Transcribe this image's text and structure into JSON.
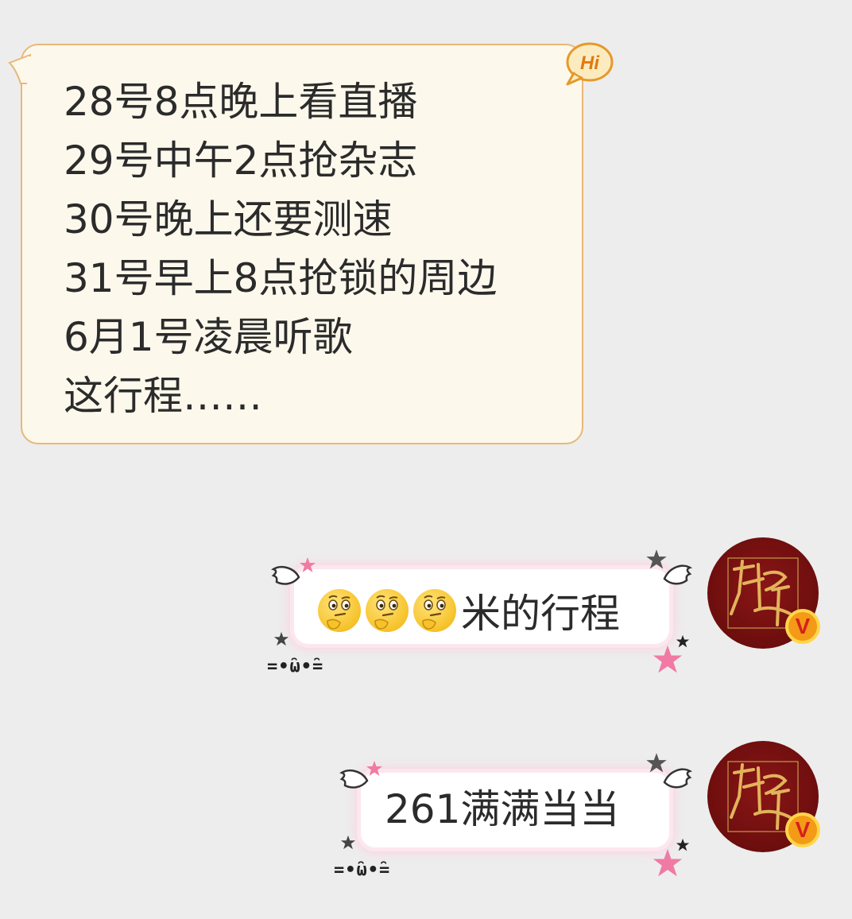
{
  "received_message": {
    "lines": [
      "28号8点晚上看直播",
      "29号中午2点抢杂志",
      "30号晚上还要测速",
      "31号早上8点抢锁的周边",
      "6月1号凌晨听歌",
      "这行程……"
    ],
    "badge_text": "Hi"
  },
  "sent_messages": [
    {
      "emoji_count": 3,
      "text": "米的行程",
      "emoji": "thinking-face"
    },
    {
      "text": "261满满当当"
    }
  ],
  "avatar": {
    "verified_mark": "V"
  },
  "decoration": {
    "kaomoji": "=•̑ω•̑="
  },
  "colors": {
    "background": "#ededed",
    "received_bubble": "#fdf8ec",
    "received_border": "#e8b878",
    "avatar": "#7a1010",
    "badge": "#f39a16"
  }
}
